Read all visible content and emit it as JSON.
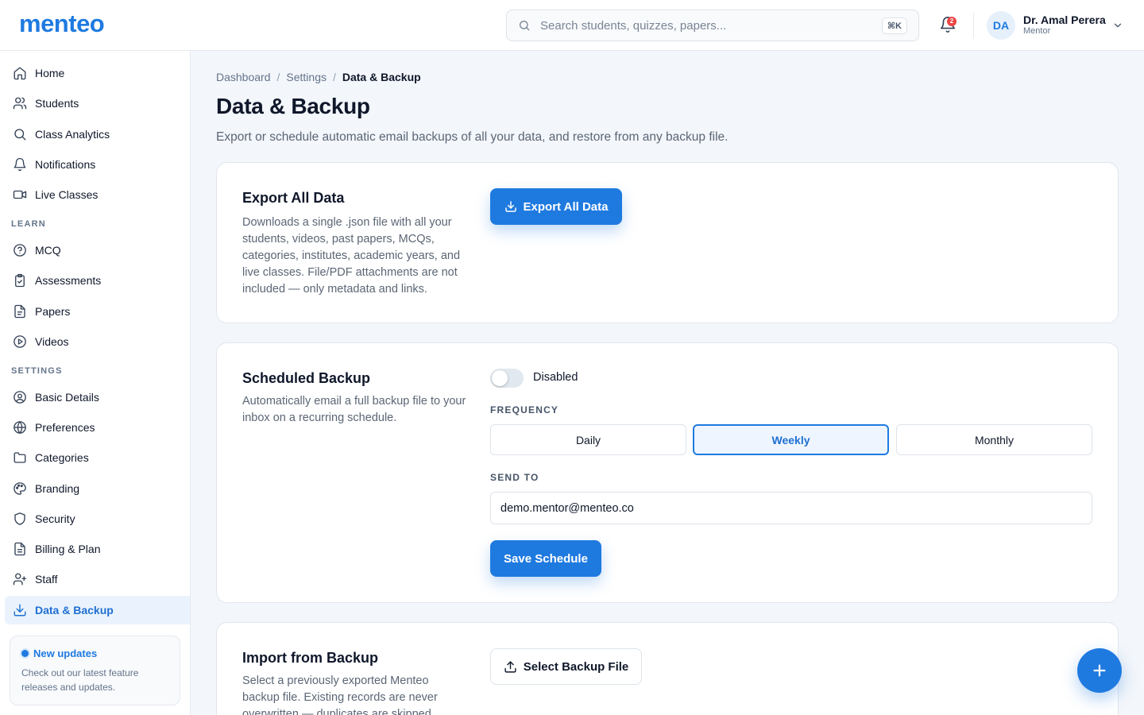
{
  "app": {
    "logo": "menteo"
  },
  "search": {
    "placeholder": "Search students, quizzes, papers...",
    "shortcut": "⌘K"
  },
  "notifications": {
    "count": "2"
  },
  "user": {
    "initials": "DA",
    "name": "Dr. Amal Perera",
    "role": "Mentor"
  },
  "sidebar": {
    "items": [
      {
        "label": "Home",
        "icon": "home-icon"
      },
      {
        "label": "Students",
        "icon": "users-icon"
      },
      {
        "label": "Class Analytics",
        "icon": "search-icon"
      },
      {
        "label": "Notifications",
        "icon": "bell-icon"
      },
      {
        "label": "Live Classes",
        "icon": "video-icon"
      }
    ],
    "learn_title": "LEARN",
    "learn": [
      {
        "label": "MCQ",
        "icon": "help-circle-icon"
      },
      {
        "label": "Assessments",
        "icon": "clipboard-check-icon"
      },
      {
        "label": "Papers",
        "icon": "file-icon"
      },
      {
        "label": "Videos",
        "icon": "play-circle-icon"
      }
    ],
    "settings_title": "SETTINGS",
    "settings": [
      {
        "label": "Basic Details",
        "icon": "user-circle-icon"
      },
      {
        "label": "Preferences",
        "icon": "globe-icon"
      },
      {
        "label": "Categories",
        "icon": "folder-icon"
      },
      {
        "label": "Branding",
        "icon": "palette-icon"
      },
      {
        "label": "Security",
        "icon": "shield-icon"
      },
      {
        "label": "Billing & Plan",
        "icon": "file-text-icon"
      },
      {
        "label": "Staff",
        "icon": "user-plus-icon"
      },
      {
        "label": "Data & Backup",
        "icon": "download-icon",
        "active": true
      }
    ],
    "updates": {
      "title": "New updates",
      "text": "Check out our latest feature releases and updates."
    }
  },
  "breadcrumb": [
    "Dashboard",
    "Settings",
    "Data & Backup"
  ],
  "page": {
    "title": "Data & Backup",
    "subtitle": "Export or schedule automatic email backups of all your data, and restore from any backup file."
  },
  "export_card": {
    "title": "Export All Data",
    "description": "Downloads a single .json file with all your students, videos, past papers, MCQs, categories, institutes, academic years, and live classes. File/PDF attachments are not included — only metadata and links.",
    "button": "Export All Data"
  },
  "schedule_card": {
    "title": "Scheduled Backup",
    "description": "Automatically email a full backup file to your inbox on a recurring schedule.",
    "toggle_state": "Disabled",
    "enabled": false,
    "frequency_label": "FREQUENCY",
    "frequency_options": [
      "Daily",
      "Weekly",
      "Monthly"
    ],
    "frequency_selected": "Weekly",
    "send_to_label": "SEND TO",
    "send_to_value": "demo.mentor@menteo.co",
    "save_button": "Save Schedule"
  },
  "import_card": {
    "title": "Import from Backup",
    "description": "Select a previously exported Menteo backup file. Existing records are never overwritten — duplicates are skipped.",
    "button": "Select Backup File"
  },
  "colors": {
    "accent": "#1f7ae0",
    "badge": "#ef4444"
  }
}
